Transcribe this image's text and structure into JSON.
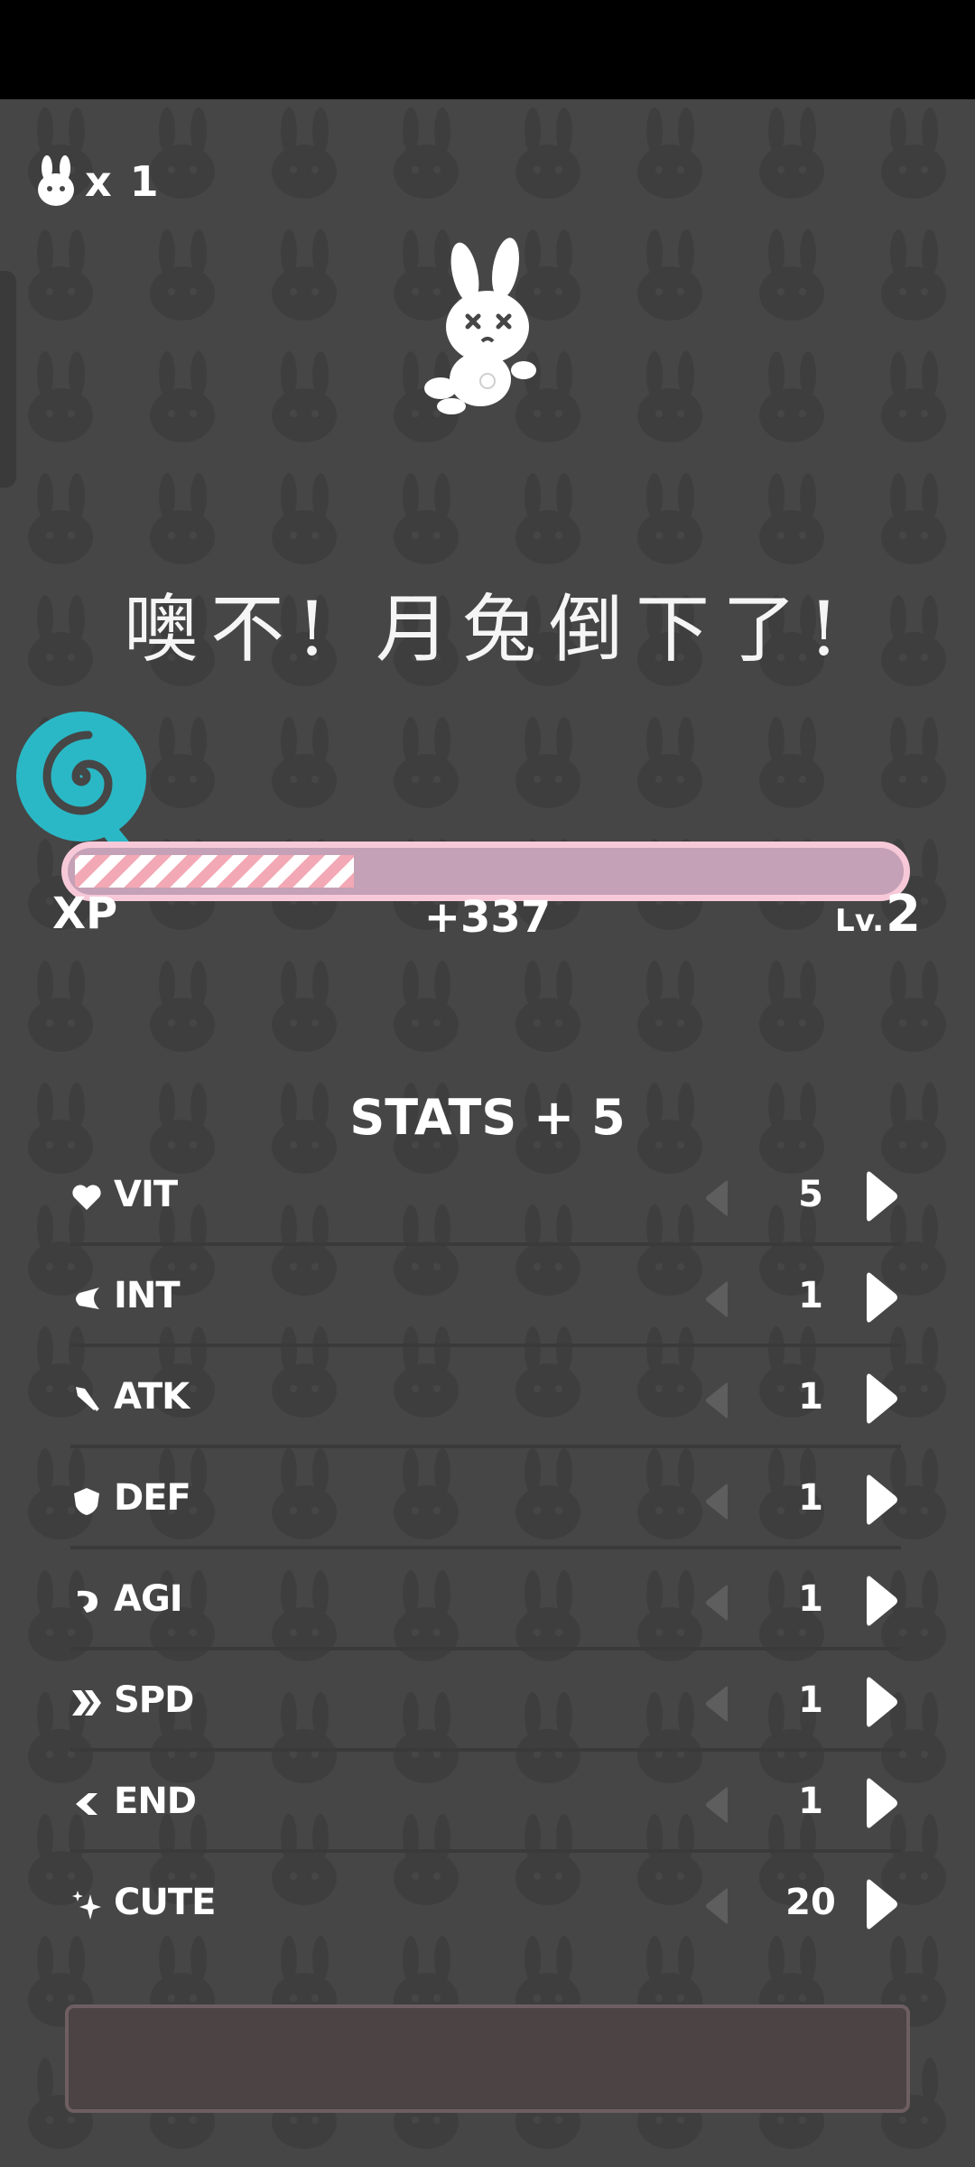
{
  "lives": {
    "icon": "bunny-head-icon",
    "count": "x 1"
  },
  "defeat_message": "噢不! 月兔倒下了!",
  "xp": {
    "label": "XP",
    "gain": "+337",
    "level_prefix": "Lv.",
    "level": "2",
    "progress": 0.34,
    "fill_pattern_colors": [
      "#f3a8b5",
      "#ffffff"
    ],
    "track_color": "#c4a1b6",
    "border_color": "#f7c9d8"
  },
  "lollipop": {
    "icon": "lollipop-icon",
    "color": "#2ab8c6"
  },
  "stats": {
    "title": "STATS + 5",
    "rows": [
      {
        "icon": "heart-icon",
        "label": "VIT",
        "value": "5"
      },
      {
        "icon": "brain-icon",
        "label": "INT",
        "value": "1"
      },
      {
        "icon": "sword-icon",
        "label": "ATK",
        "value": "1"
      },
      {
        "icon": "shield-icon",
        "label": "DEF",
        "value": "1"
      },
      {
        "icon": "swirl-icon",
        "label": "AGI",
        "value": "1"
      },
      {
        "icon": "double-chevron-icon",
        "label": "SPD",
        "value": "1"
      },
      {
        "icon": "chevron-left-icon",
        "label": "END",
        "value": "1"
      },
      {
        "icon": "sparkle-icon",
        "label": "CUTE",
        "value": "20"
      }
    ]
  },
  "colors": {
    "background": "#464646",
    "pattern": "#3b3b3b",
    "confirm_border": "#6e5e62"
  }
}
